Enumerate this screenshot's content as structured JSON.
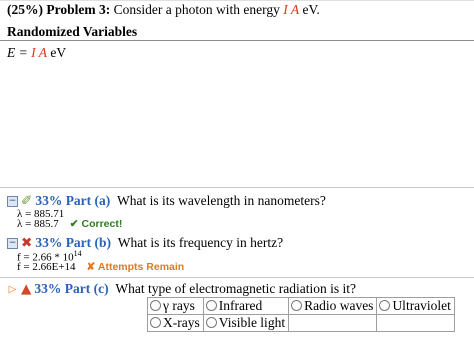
{
  "problem": {
    "percent": "(25%)",
    "label": "Problem 3:",
    "text_before": "Consider a photon with energy",
    "var_name": "I A",
    "unit": "eV."
  },
  "randomized": {
    "title": "Randomized Variables",
    "eq_left": "E =",
    "var_name": "I A",
    "unit": "eV"
  },
  "part_a": {
    "toggle": "−",
    "status_icon": "check-pencil-icon",
    "percent": "33%",
    "part": "Part (a)",
    "question": "What is its wavelength in nanometers?",
    "answers": [
      {
        "text": "λ = 885.71",
        "feedback": ""
      },
      {
        "text": "λ = 885.7",
        "feedback": "✔ Correct!"
      }
    ]
  },
  "part_b": {
    "toggle": "−",
    "status_icon": "cross-mark-icon",
    "percent": "33%",
    "part": "Part (b)",
    "question": "What is its frequency in hertz?",
    "answer1_base": "f = 2.66 * 10",
    "answer1_exp": "14",
    "answer2": "f = 2.66E+14",
    "feedback": "✘ Attempts Remain"
  },
  "part_c": {
    "toggle": "▷",
    "status_icon": "warning-triangle-icon",
    "percent": "33%",
    "part": "Part (c)",
    "question": "What type of electromagnetic radiation is it?",
    "choices_row1": [
      "γ rays",
      "Infrared",
      "Radio waves",
      "Ultraviolet"
    ],
    "choices_row2": [
      "X-rays",
      "Visible light",
      "",
      ""
    ]
  },
  "colors": {
    "accent_blue": "#2a63b8",
    "variable_red": "#d43b1e",
    "correct_green": "#2f7d22",
    "attempts_orange": "#e07a1f"
  }
}
